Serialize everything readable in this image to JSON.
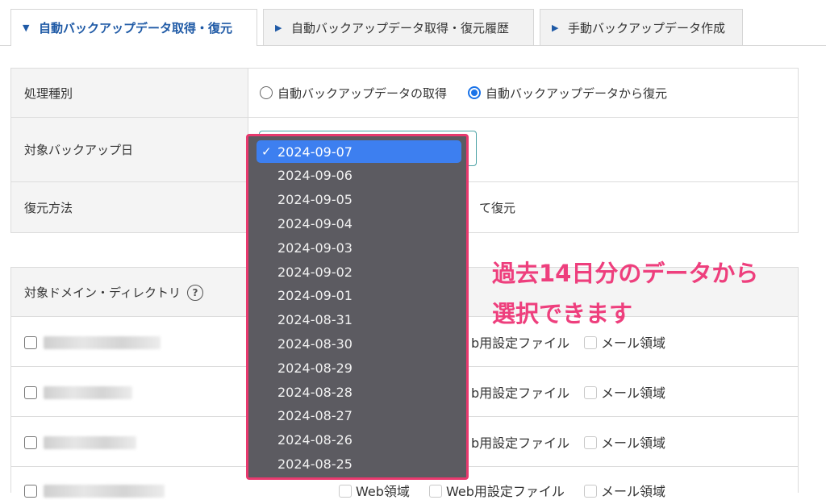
{
  "tabs": [
    {
      "label": "自動バックアップデータ取得・復元",
      "active": true
    },
    {
      "label": "自動バックアップデータ取得・復元履歴",
      "active": false
    },
    {
      "label": "手動バックアップデータ作成",
      "active": false
    }
  ],
  "form": {
    "process_type": {
      "label": "処理種別",
      "options": [
        "自動バックアップデータの取得",
        "自動バックアップデータから復元"
      ],
      "selected": "自動バックアップデータから復元"
    },
    "backup_date": {
      "label": "対象バックアップ日",
      "value": "2024-09-07"
    },
    "restore_method": {
      "label": "復元方法",
      "visible_value": "て復元"
    }
  },
  "domain_table": {
    "header": "対象ドメイン・ディレクトリ",
    "help_icon": "?",
    "rows": [
      {
        "partial_option": "b用設定ファイル",
        "mail_option": "メール領域"
      },
      {
        "partial_option": "b用設定ファイル",
        "mail_option": "メール領域"
      },
      {
        "partial_option": "b用設定ファイル",
        "mail_option": "メール領域"
      },
      {
        "web_option": "Web領域",
        "settings_option": "Web用設定ファイル",
        "mail_option": "メール領域"
      }
    ]
  },
  "dropdown": {
    "options": [
      "2024-09-07",
      "2024-09-06",
      "2024-09-05",
      "2024-09-04",
      "2024-09-03",
      "2024-09-02",
      "2024-09-01",
      "2024-08-31",
      "2024-08-30",
      "2024-08-29",
      "2024-08-28",
      "2024-08-27",
      "2024-08-26",
      "2024-08-25"
    ],
    "selected_index": 0,
    "check_mark": "✓"
  },
  "annotation": {
    "line1": "過去14日分のデータから",
    "line2": "選択できます"
  },
  "colors": {
    "accent": "#1f5aa6",
    "highlight": "#e8396e",
    "annotation": "#ee3f7d",
    "dropdown_bg": "#5c5b61",
    "selected": "#3d7ff0"
  }
}
